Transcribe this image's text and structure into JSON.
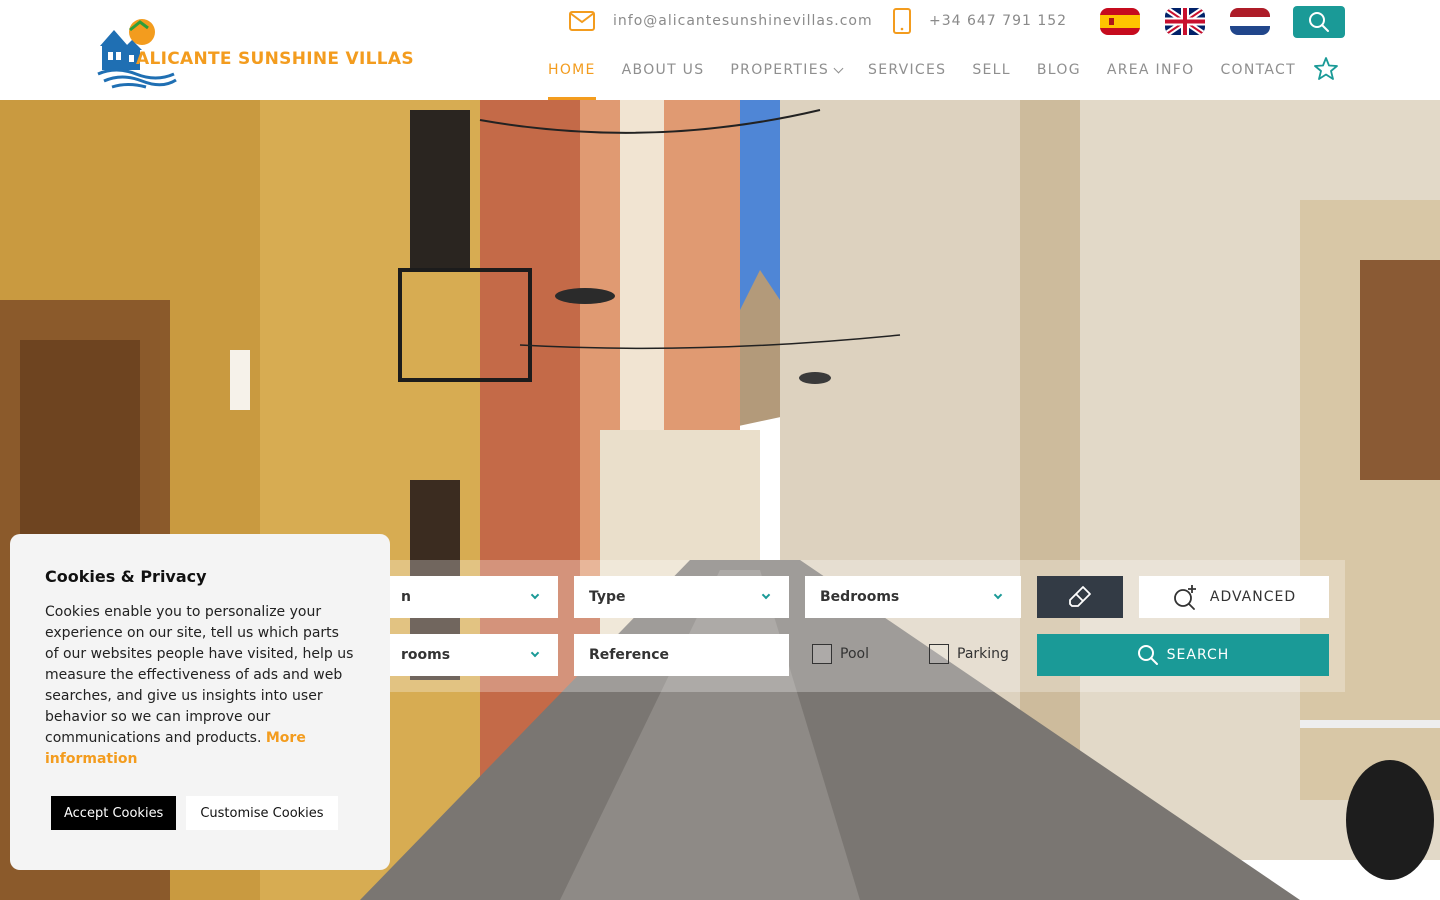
{
  "brand": {
    "logo_text": "ALICANTE SUNSHINE VILLAS",
    "primary_color": "#1a9a97",
    "accent_color": "#f39c1e"
  },
  "topbar": {
    "email": "info@alicantesunshinevillas.com",
    "phone": "+34 647 791 152",
    "email_icon": "mail-icon",
    "phone_icon": "mobile-phone-icon",
    "languages": [
      "es",
      "en",
      "nl"
    ]
  },
  "nav": {
    "items": [
      {
        "label": "HOME",
        "active": true
      },
      {
        "label": "ABOUT US"
      },
      {
        "label": "PROPERTIES",
        "dropdown": true
      },
      {
        "label": "SERVICES"
      },
      {
        "label": "SELL"
      },
      {
        "label": "BLOG"
      },
      {
        "label": "AREA INFO"
      },
      {
        "label": "CONTACT"
      }
    ]
  },
  "search": {
    "location_visible": "n",
    "bathrooms_visible": "rooms",
    "type": "Type",
    "bedrooms": "Bedrooms",
    "reference_placeholder": "Reference",
    "pool": "Pool",
    "parking": "Parking",
    "advanced": "ADVANCED",
    "search_btn": "SEARCH"
  },
  "cookie": {
    "title": "Cookies & Privacy",
    "body": "Cookies enable you to personalize your experience on our site, tell us which parts of our websites people have visited, help us measure the effectiveness of ads and web searches, and give us insights into user behavior so we can improve our communications and products.",
    "more": "More information",
    "accept": "Accept Cookies",
    "customise": "Customise Cookies"
  }
}
